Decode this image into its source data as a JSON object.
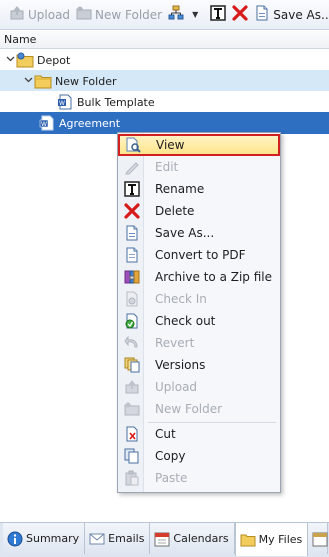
{
  "toolbar": {
    "upload": "Upload",
    "new_folder": "New Folder",
    "save_as": "Save As..."
  },
  "column_header": {
    "name": "Name"
  },
  "tree": {
    "depot": "Depot",
    "new_folder": "New Folder",
    "bulk_template": "Bulk Template",
    "agreement": "Agreement"
  },
  "context_menu": {
    "items": [
      {
        "label": "View",
        "enabled": true,
        "highlighted": true,
        "icon": "view-icon"
      },
      {
        "label": "Edit",
        "enabled": false,
        "icon": "pencil-icon"
      },
      {
        "label": "Rename",
        "enabled": true,
        "icon": "rename-icon"
      },
      {
        "label": "Delete",
        "enabled": true,
        "icon": "delete-icon"
      },
      {
        "label": "Save As...",
        "enabled": true,
        "icon": "save-as-icon"
      },
      {
        "label": "Convert to PDF",
        "enabled": true,
        "icon": "pdf-icon"
      },
      {
        "label": "Archive to a Zip file",
        "enabled": true,
        "icon": "zip-icon"
      },
      {
        "label": "Check In",
        "enabled": false,
        "icon": "check-in-icon"
      },
      {
        "label": "Check out",
        "enabled": true,
        "icon": "check-out-icon"
      },
      {
        "label": "Revert",
        "enabled": false,
        "icon": "revert-icon"
      },
      {
        "label": "Versions",
        "enabled": true,
        "icon": "versions-icon"
      },
      {
        "label": "Upload",
        "enabled": false,
        "icon": "upload-icon"
      },
      {
        "label": "New Folder",
        "enabled": false,
        "icon": "new-folder-icon"
      },
      {
        "label": "Cut",
        "enabled": true,
        "icon": "cut-icon"
      },
      {
        "label": "Copy",
        "enabled": true,
        "icon": "copy-icon"
      },
      {
        "label": "Paste",
        "enabled": false,
        "icon": "paste-icon"
      }
    ]
  },
  "tabs": {
    "summary": "Summary",
    "emails": "Emails",
    "calendars": "Calendars",
    "my_files": "My Files",
    "active": "My Files"
  },
  "colors": {
    "selection": "#2e6fc2",
    "highlight_border": "#d21f1f",
    "highlight_fill": "#fde58c"
  }
}
